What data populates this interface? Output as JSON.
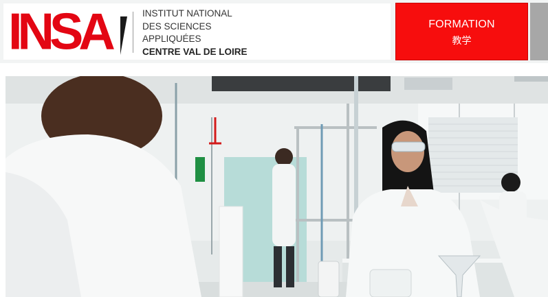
{
  "header": {
    "logo_text": "INSA",
    "institution_lines": [
      "INSTITUT NATIONAL",
      "DES SCIENCES",
      "APPLIQUÉES"
    ],
    "campus_line": "CENTRE VAL DE LOIRE"
  },
  "nav": {
    "formation_label": "FORMATION",
    "formation_sublabel": "教学"
  },
  "colors": {
    "brand_red": "#e30613",
    "nav_red": "#f70d0d",
    "nav_grey": "#a7a7a7"
  },
  "hero": {
    "description_icon": "laboratory-photo"
  }
}
